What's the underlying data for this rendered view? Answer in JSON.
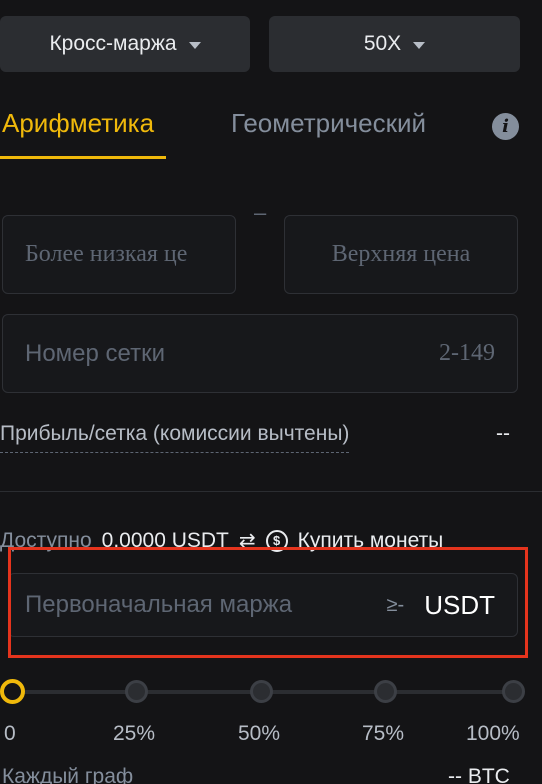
{
  "selects": {
    "margin_mode": "Кросс-маржа",
    "leverage": "50X"
  },
  "tabs": {
    "arithmetic": "Арифметика",
    "geometric": "Геометрический"
  },
  "price_range": {
    "lower_placeholder": "Более низкая це",
    "separator": "–",
    "upper_placeholder": "Верхняя цена"
  },
  "grid": {
    "placeholder": "Номер сетки",
    "range_hint": "2-149"
  },
  "profit": {
    "label": "Прибыль/сетка (комиссии вычтены)",
    "value": "--"
  },
  "available": {
    "label": "Доступно",
    "value": "0.0000 USDT",
    "buy_label": "Купить монеты"
  },
  "margin_input": {
    "placeholder": "Первоначальная маржа",
    "min_hint": "≥-",
    "unit": "USDT"
  },
  "slider": {
    "value_percent": 0,
    "marks": [
      "0",
      "25%",
      "50%",
      "75%",
      "100%"
    ]
  },
  "each": {
    "label": "Каждый граф",
    "value": "-- BTC"
  },
  "colors": {
    "accent": "#f0b90b",
    "highlight": "#e5341d",
    "background": "#141416"
  },
  "icons": {
    "info": "info-icon",
    "transfer": "transfer-icon",
    "dollar": "dollar-circle-icon"
  }
}
